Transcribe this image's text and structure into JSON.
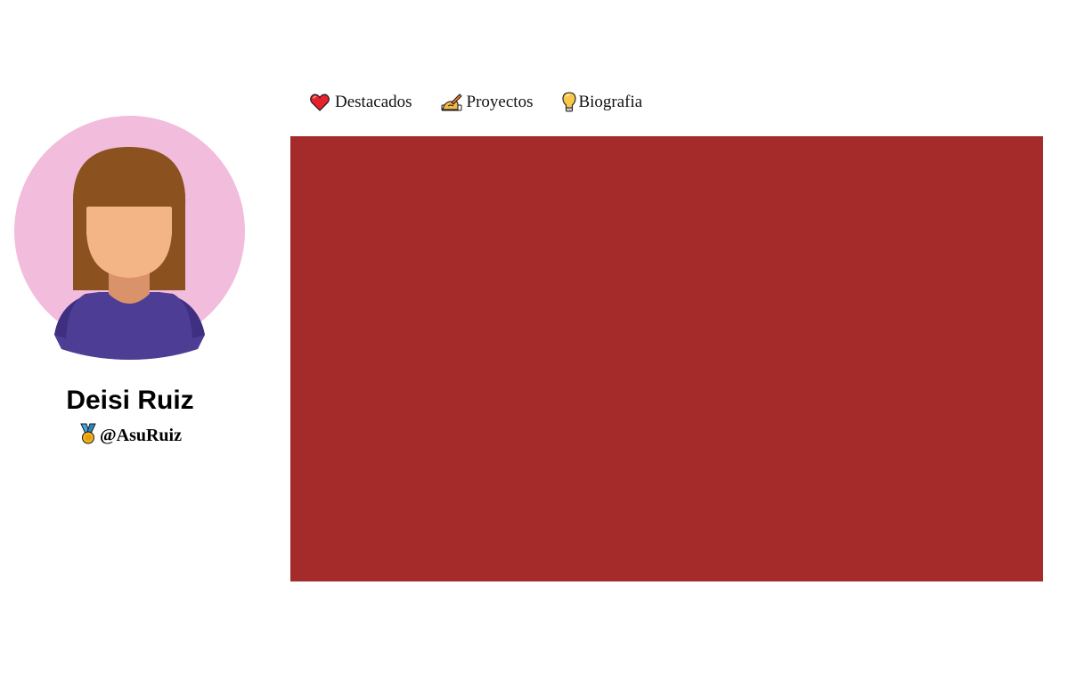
{
  "profile": {
    "name": "Deisi Ruiz",
    "handle": "@AsuRuiz",
    "handle_icon": "medal-icon",
    "avatar_bg_color": "#f2bcdc"
  },
  "tabs": [
    {
      "label": "Destacados",
      "icon": "heart-icon"
    },
    {
      "label": "Proyectos",
      "icon": "writing-hand-icon"
    },
    {
      "label": "Biografia",
      "icon": "lightbulb-icon"
    }
  ],
  "content": {
    "panel_color": "#a52a2a"
  }
}
